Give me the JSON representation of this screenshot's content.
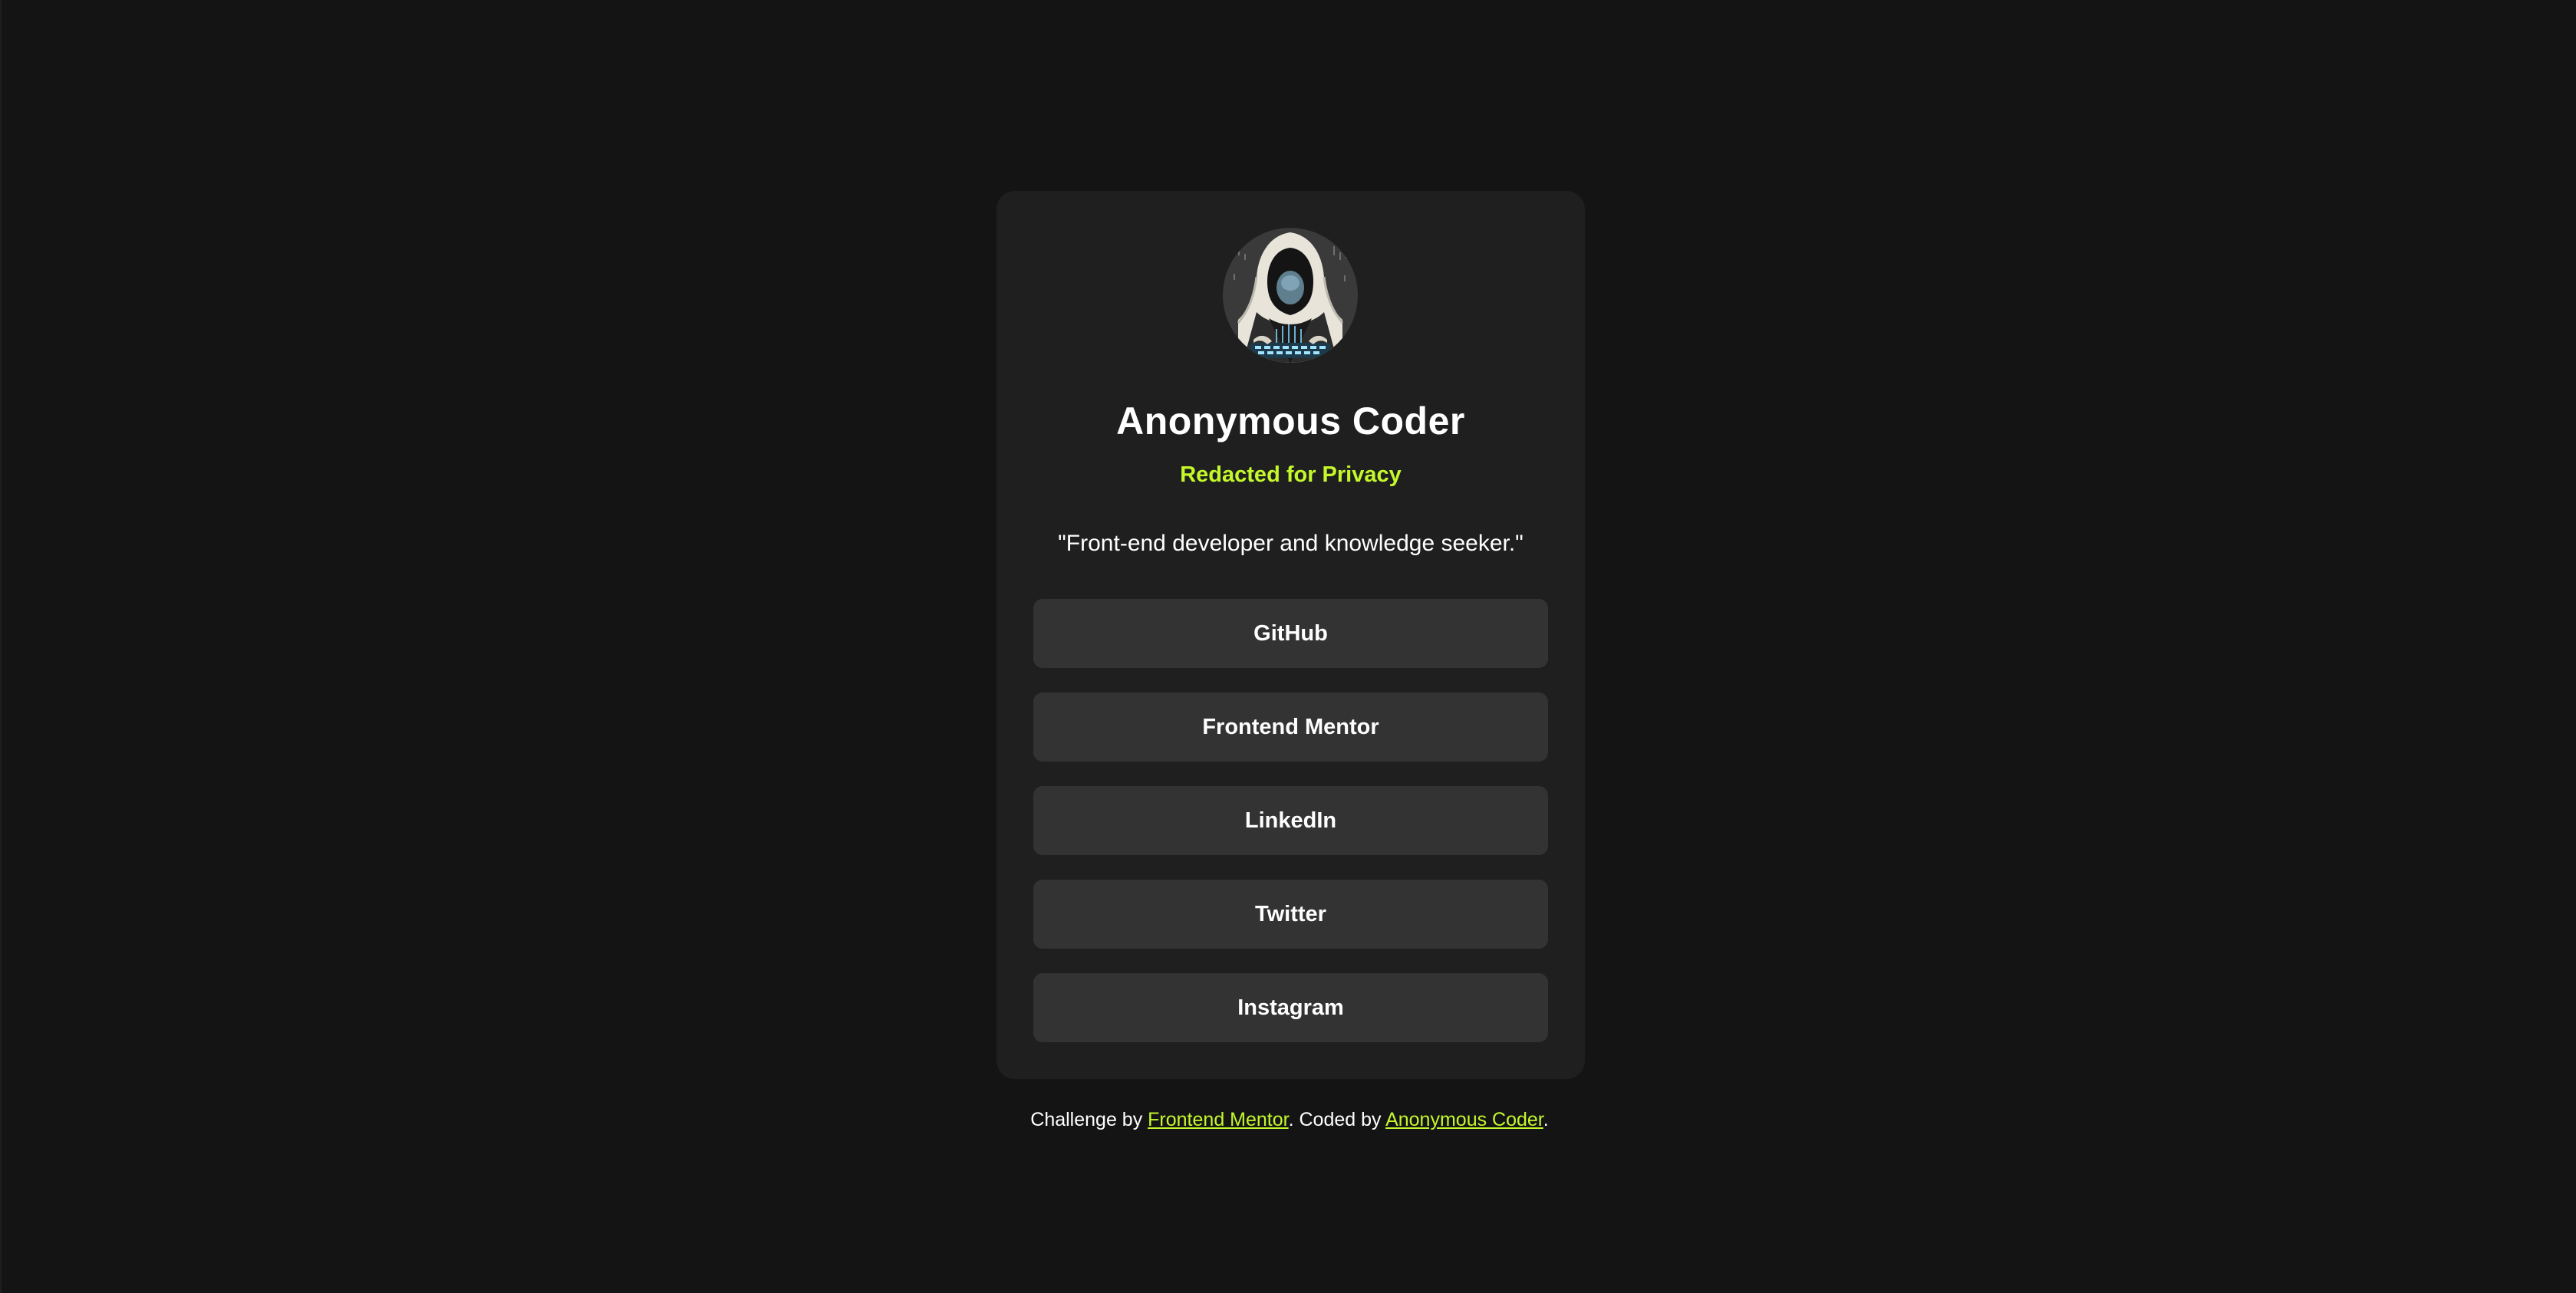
{
  "profile": {
    "avatar_alt": "hooded-figure-avatar",
    "name": "Anonymous Coder",
    "location": "Redacted for Privacy",
    "bio": "\"Front-end developer and knowledge seeker.\""
  },
  "links": [
    {
      "label": "GitHub"
    },
    {
      "label": "Frontend Mentor"
    },
    {
      "label": "LinkedIn"
    },
    {
      "label": "Twitter"
    },
    {
      "label": "Instagram"
    }
  ],
  "footer": {
    "prefix": "Challenge by ",
    "challenge_link": "Frontend Mentor",
    "middle": ". Coded by ",
    "author_link": "Anonymous Coder",
    "suffix": "."
  },
  "colors": {
    "page_background": "#141414",
    "card_background": "#1f1f1f",
    "button_background": "#333333",
    "accent": "#c4f82a",
    "text": "#ffffff"
  }
}
